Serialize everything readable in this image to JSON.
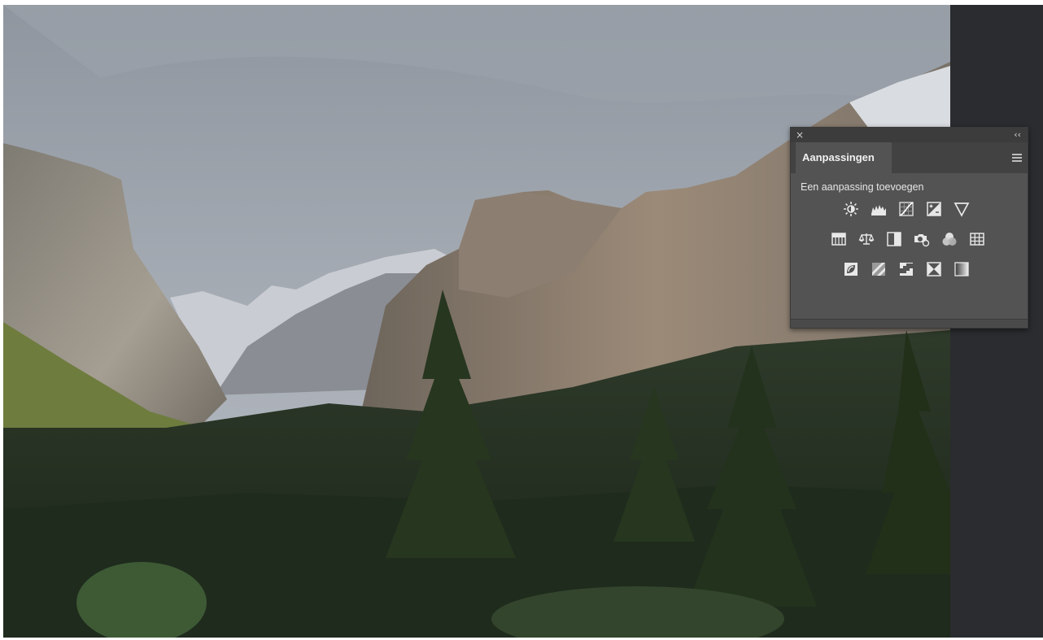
{
  "panel": {
    "close_glyph": "×",
    "collapse_glyph": "‹‹",
    "tab_label": "Aanpassingen",
    "menu_icon": "hamburger-menu-icon",
    "subtitle": "Een aanpassing toevoegen",
    "icon_rows": [
      [
        "brightness-contrast-icon",
        "levels-icon",
        "curves-icon",
        "exposure-icon",
        "vibrance-icon"
      ],
      [
        "hue-saturation-icon",
        "color-balance-icon",
        "black-white-icon",
        "photo-filter-icon",
        "channel-mixer-icon",
        "color-lookup-icon"
      ],
      [
        "invert-icon",
        "posterize-icon",
        "threshold-icon",
        "selective-color-icon",
        "gradient-map-icon"
      ]
    ]
  },
  "colors": {
    "panel_bg": "#535353",
    "panel_dark": "#3c3c3c",
    "side_bg": "#2a2c2f",
    "icon": "#e8e8e8"
  }
}
